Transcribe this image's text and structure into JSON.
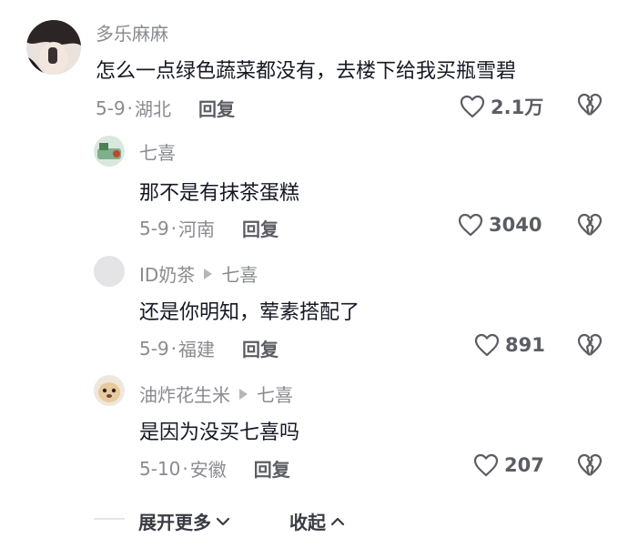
{
  "comments": [
    {
      "username": "多乐麻麻",
      "reply_to": "",
      "text": "怎么一点绿色蔬菜都没有，去楼下给我买瓶雪碧",
      "date": "5-9",
      "location": "湖北",
      "reply_label": "回复",
      "likes": "2.1万"
    },
    {
      "username": "七喜",
      "reply_to": "",
      "text": "那不是有抹茶蛋糕",
      "date": "5-9",
      "location": "河南",
      "reply_label": "回复",
      "likes": "3040"
    },
    {
      "username": "ID奶茶",
      "reply_to": "七喜",
      "text": "还是你明知，荤素搭配了",
      "date": "5-9",
      "location": "福建",
      "reply_label": "回复",
      "likes": "891"
    },
    {
      "username": "油炸花生米",
      "reply_to": "七喜",
      "text": "是因为没买七喜吗",
      "date": "5-10",
      "location": "安徽",
      "reply_label": "回复",
      "likes": "207"
    }
  ],
  "meta_separator": "·",
  "footer": {
    "expand_label": "展开更多",
    "collapse_label": "收起"
  }
}
